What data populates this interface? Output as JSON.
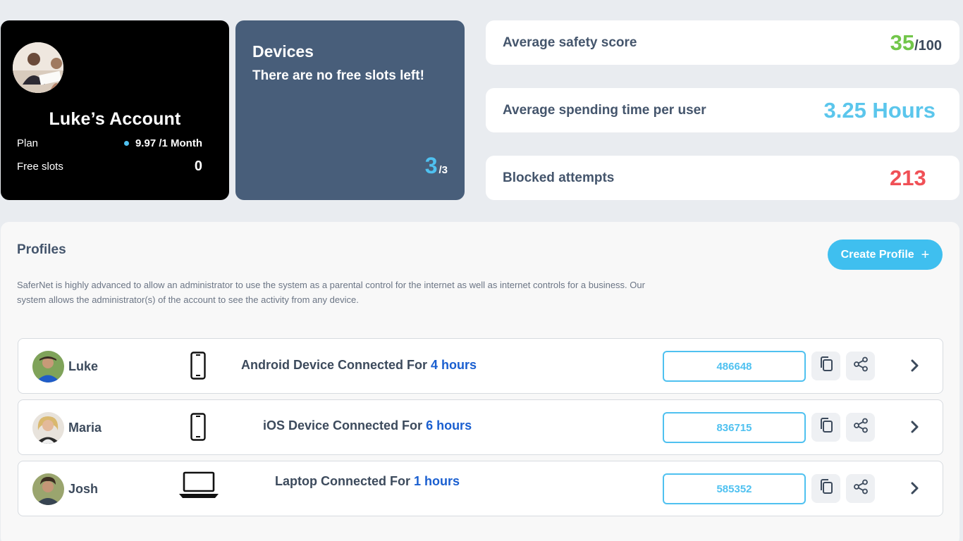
{
  "account": {
    "title": "Luke’s Account",
    "plan_label": "Plan",
    "plan_value": "9.97 /1 Month",
    "free_slots_label": "Free slots",
    "free_slots_value": "0"
  },
  "devices": {
    "title": "Devices",
    "subtitle": "There are no free slots left!",
    "used": "3",
    "total": "/3"
  },
  "stats": {
    "safety_label": "Average safety score",
    "safety_value": "35",
    "safety_max": "/100",
    "time_label": "Average spending time per user",
    "time_value": "3.25 Hours",
    "blocked_label": "Blocked attempts",
    "blocked_value": "213"
  },
  "profiles": {
    "title": "Profiles",
    "create_label": "Create Profile",
    "create_icon": "+",
    "description": "SaferNet is highly advanced to allow an administrator to use the system as a parental control for the internet as well as internet controls for a business. Our system allows the administrator(s) of the account to see the activity from any device.",
    "rows": [
      {
        "name": "Luke",
        "device_icon": "phone-icon",
        "status_text": "Android Device Connected For ",
        "status_hours": "4 hours",
        "code": "486648"
      },
      {
        "name": "Maria",
        "device_icon": "phone-icon",
        "status_text": "iOS Device Connected For ",
        "status_hours": "6 hours",
        "code": "836715"
      },
      {
        "name": "Josh",
        "device_icon": "laptop-icon",
        "status_text": "Laptop Connected For ",
        "status_hours": "1 hours",
        "code": "585352"
      }
    ]
  },
  "colors": {
    "accent": "#4fc1f0",
    "safety": "#72c64a",
    "time": "#5bc6ec",
    "blocked": "#f05056",
    "hours_highlight": "#1a5fd0",
    "devices_card": "#485e7a"
  }
}
